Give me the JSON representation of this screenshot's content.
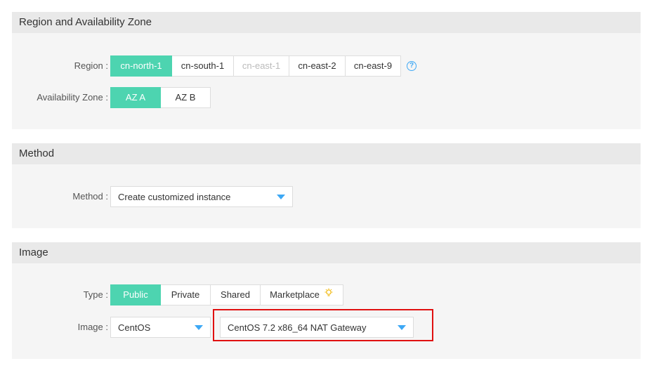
{
  "region_section": {
    "title": "Region and Availability Zone",
    "region_label": "Region :",
    "regions": [
      {
        "label": "cn-north-1",
        "state": "active"
      },
      {
        "label": "cn-south-1",
        "state": "normal"
      },
      {
        "label": "cn-east-1",
        "state": "disabled"
      },
      {
        "label": "cn-east-2",
        "state": "normal"
      },
      {
        "label": "cn-east-9",
        "state": "normal"
      }
    ],
    "help_icon": "question-circle-icon",
    "help_glyph": "?",
    "az_label": "Availability Zone :",
    "zones": [
      {
        "label": "AZ A",
        "state": "active"
      },
      {
        "label": "AZ B",
        "state": "normal"
      }
    ]
  },
  "method_section": {
    "title": "Method",
    "method_label": "Method :",
    "method_value": "Create customized instance"
  },
  "image_section": {
    "title": "Image",
    "type_label": "Type :",
    "types": [
      {
        "label": "Public",
        "state": "active"
      },
      {
        "label": "Private",
        "state": "normal"
      },
      {
        "label": "Shared",
        "state": "normal"
      },
      {
        "label": "Marketplace",
        "state": "normal"
      }
    ],
    "marketplace_icon": "lightbulb-icon",
    "image_label": "Image :",
    "os_value": "CentOS",
    "version_value": "CentOS 7.2 x86_64 NAT Gateway"
  },
  "colors": {
    "accent": "#4dd4b0",
    "caret": "#3da8f5",
    "highlight": "#e01010",
    "section_bg": "#f5f5f5",
    "header_bg": "#e9e9e9"
  }
}
